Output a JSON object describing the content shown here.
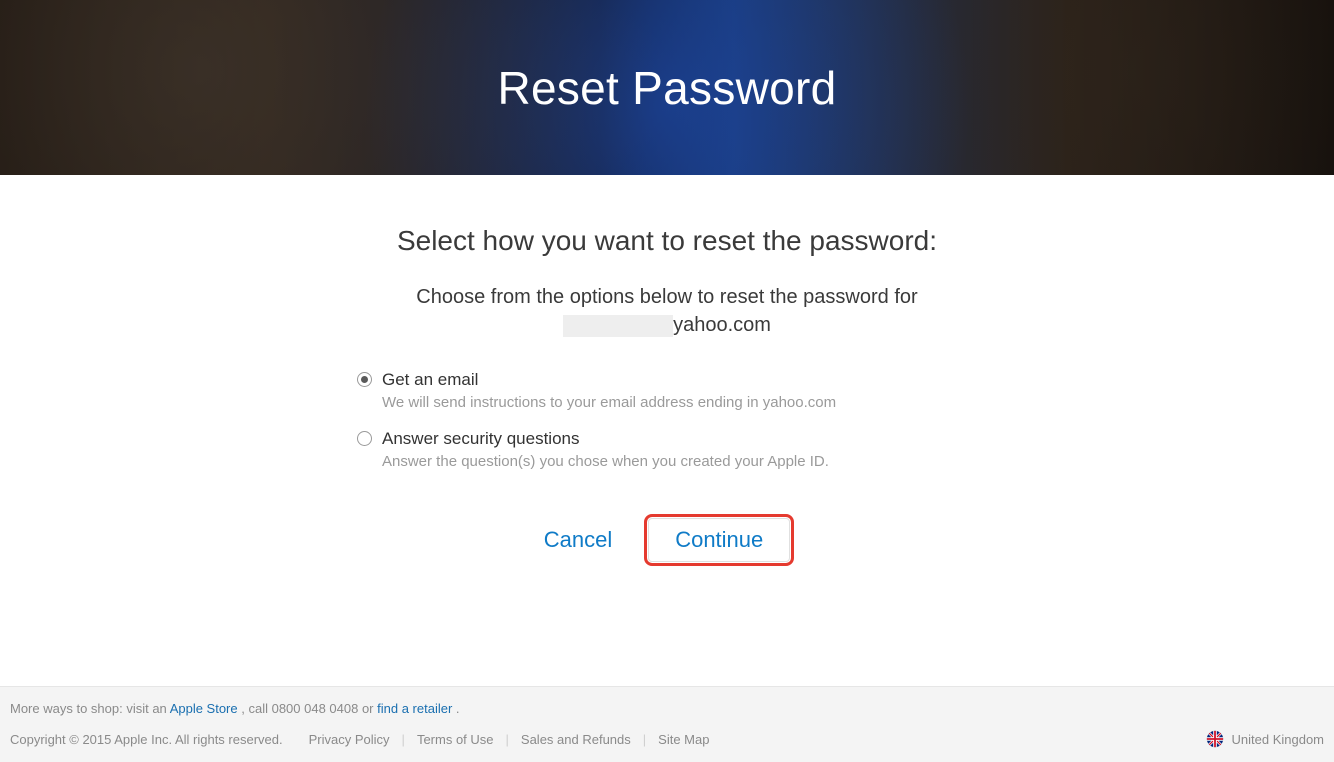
{
  "header": {
    "title": "Reset Password"
  },
  "main": {
    "subhead": "Select how you want to reset the password:",
    "instruction": "Choose from the options below to reset the password for",
    "email_domain": "yahoo.com"
  },
  "options": [
    {
      "label": "Get an email",
      "description": "We will send instructions to your email address ending in yahoo.com",
      "selected": true
    },
    {
      "label": "Answer security questions",
      "description": "Answer the question(s) you chose when you created your Apple ID.",
      "selected": false
    }
  ],
  "actions": {
    "cancel": "Cancel",
    "continue": "Continue"
  },
  "footer": {
    "shop_prefix": "More ways to shop: visit an ",
    "shop_link1": "Apple Store",
    "shop_mid": ", call 0800 048 0408 or ",
    "shop_link2": "find a retailer",
    "shop_suffix": ".",
    "copyright": "Copyright © 2015 Apple Inc. All rights reserved.",
    "links": [
      "Privacy Policy",
      "Terms of Use",
      "Sales and Refunds",
      "Site Map"
    ],
    "region": "United Kingdom"
  }
}
